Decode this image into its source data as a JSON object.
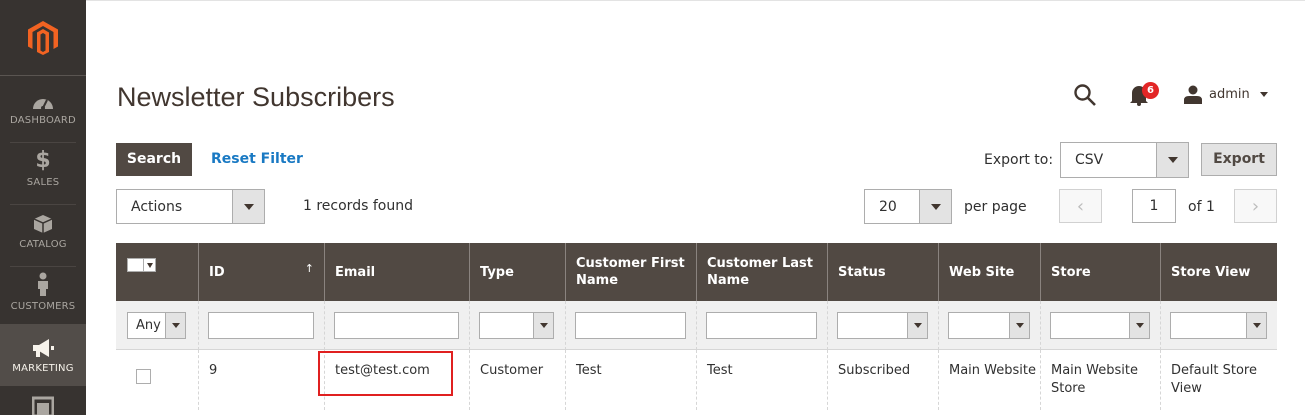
{
  "sidebar": {
    "items": [
      {
        "label": "DASHBOARD",
        "icon": "dashboard-icon"
      },
      {
        "label": "SALES",
        "icon": "dollar-icon"
      },
      {
        "label": "CATALOG",
        "icon": "box-icon"
      },
      {
        "label": "CUSTOMERS",
        "icon": "person-icon"
      },
      {
        "label": "MARKETING",
        "icon": "megaphone-icon"
      }
    ]
  },
  "header": {
    "title": "Newsletter Subscribers",
    "notifications_count": "6",
    "user_name": "admin"
  },
  "toolbar": {
    "search_label": "Search",
    "reset_label": "Reset Filter",
    "export_to_label": "Export to:",
    "export_format": "CSV",
    "export_label": "Export",
    "actions_label": "Actions",
    "records_found": "1 records found",
    "per_page_value": "20",
    "per_page_label": "per page",
    "current_page": "1",
    "of_pages": "of 1"
  },
  "grid": {
    "columns": [
      "ID",
      "Email",
      "Type",
      "Customer First\nName",
      "Customer Last\nName",
      "Status",
      "Web Site",
      "Store",
      "Store View"
    ],
    "sort_indicator": "↑",
    "filter_any": "Any",
    "rows": [
      {
        "id": "9",
        "email": "test@test.com",
        "type": "Customer",
        "first_name": "Test",
        "last_name": "Test",
        "status": "Subscribed",
        "website": "Main Website",
        "store": "Main Website Store",
        "store_view": "Default Store View"
      }
    ]
  },
  "colors": {
    "sidebar_bg": "#373330",
    "header_bg": "#514943",
    "link": "#1979c3",
    "badge": "#e22626",
    "highlight": "#e02020"
  }
}
